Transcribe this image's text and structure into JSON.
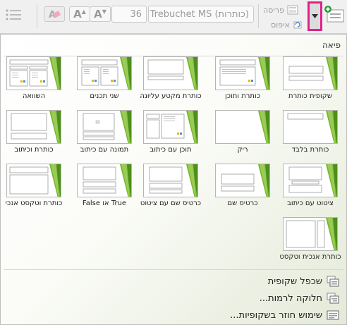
{
  "ribbon": {
    "font_size": "36",
    "font_name": "Trebuchet MS (כותרות)",
    "layout_label": "פריסה",
    "reset_label": "איפוס",
    "icons": {
      "list": "bullet-list-icon",
      "clear_formatting": "clear-formatting-icon",
      "grow_font": "grow-font-icon",
      "shrink_font": "shrink-font-icon",
      "layout": "layout-icon",
      "reset": "reset-icon",
      "dropdown": "chevron-down-icon",
      "new_slide": "new-slide-icon"
    },
    "highlight_color": "#e0218a"
  },
  "gallery": {
    "title": "פיאה",
    "theme_accent": "#76b82a",
    "layouts": [
      {
        "label": "שקופית כותרת",
        "kind": "title"
      },
      {
        "label": "כותרת ותוכן",
        "kind": "title-content"
      },
      {
        "label": "כותרת מקטע עליונה",
        "kind": "section"
      },
      {
        "label": "שני תכנים",
        "kind": "two-content"
      },
      {
        "label": "השוואה",
        "kind": "comparison"
      },
      {
        "label": "כותרת בלבד",
        "kind": "title-only"
      },
      {
        "label": "ריק",
        "kind": "blank"
      },
      {
        "label": "תוכן עם כיתוב",
        "kind": "content-caption"
      },
      {
        "label": "תמונה עם כיתוב",
        "kind": "picture-caption"
      },
      {
        "label": "כותרת וכיתוב",
        "kind": "title-caption"
      },
      {
        "label": "ציטוט עם כיתוב",
        "kind": "quote-caption"
      },
      {
        "label": "כרטיס שם",
        "kind": "name-card"
      },
      {
        "label": "כרטיס שם עם ציטוט",
        "kind": "quote-name-card"
      },
      {
        "label": "True או False",
        "kind": "true-false"
      },
      {
        "label": "כותרת וטקסט אנכי",
        "kind": "vertical-text"
      },
      {
        "label": "כותרת אנכית וטקסט",
        "kind": "vertical-title"
      }
    ]
  },
  "menu": {
    "duplicate": "שכפל שקופית",
    "outline": "חלוקה לרמות...",
    "reuse": "שימוש חוזר בשקופיות..."
  }
}
